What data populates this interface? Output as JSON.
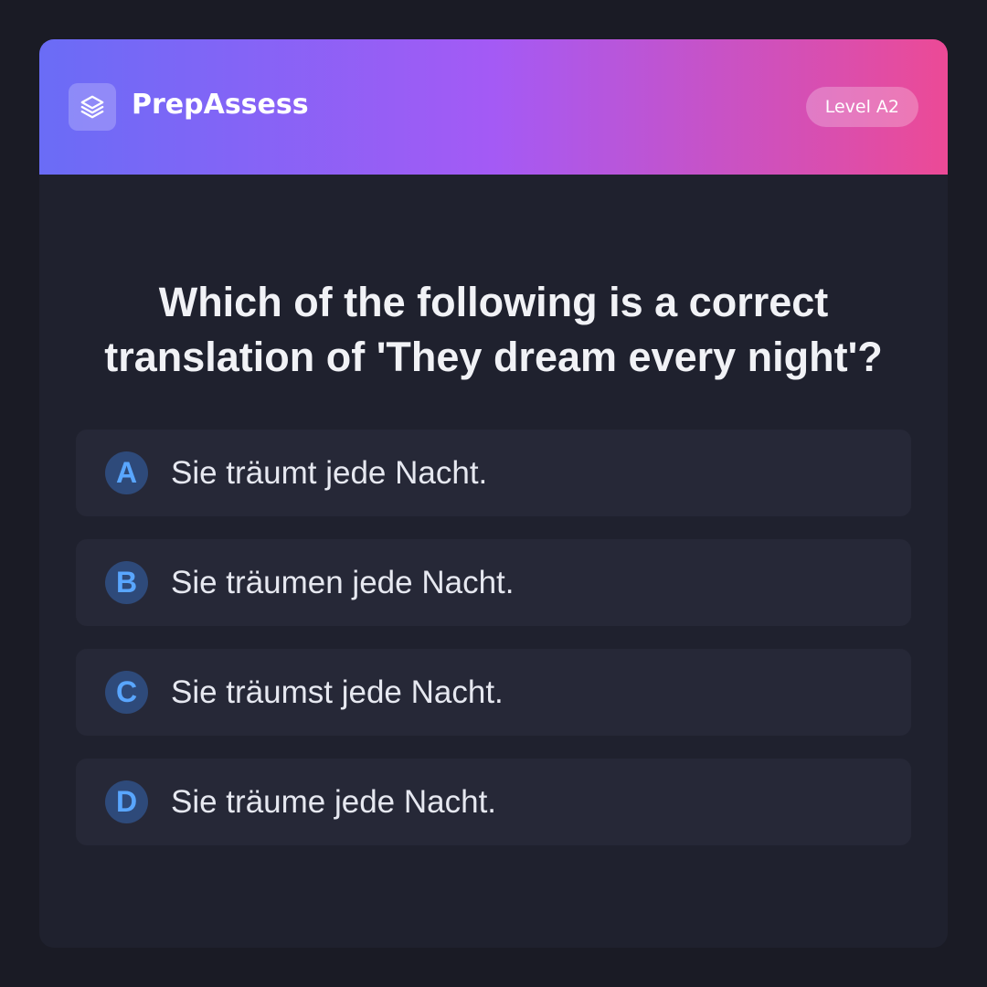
{
  "header": {
    "brand": "PrepAssess",
    "logo_icon": "layers-icon",
    "level_badge": "Level A2"
  },
  "question": {
    "text": "Which of the following is a correct translation of 'They dream every night'?"
  },
  "options": [
    {
      "letter": "A",
      "text": "Sie träumt jede Nacht."
    },
    {
      "letter": "B",
      "text": "Sie träumen jede Nacht."
    },
    {
      "letter": "C",
      "text": "Sie träumst jede Nacht."
    },
    {
      "letter": "D",
      "text": "Sie träume jede Nacht."
    }
  ],
  "colors": {
    "background": "#1a1b25",
    "card": "#1f212e",
    "option_bg": "#262837",
    "gradient_start": "#6a6cf6",
    "gradient_mid": "#a45af5",
    "gradient_end": "#ec4a96",
    "accent_letter": "#59a6ff"
  }
}
